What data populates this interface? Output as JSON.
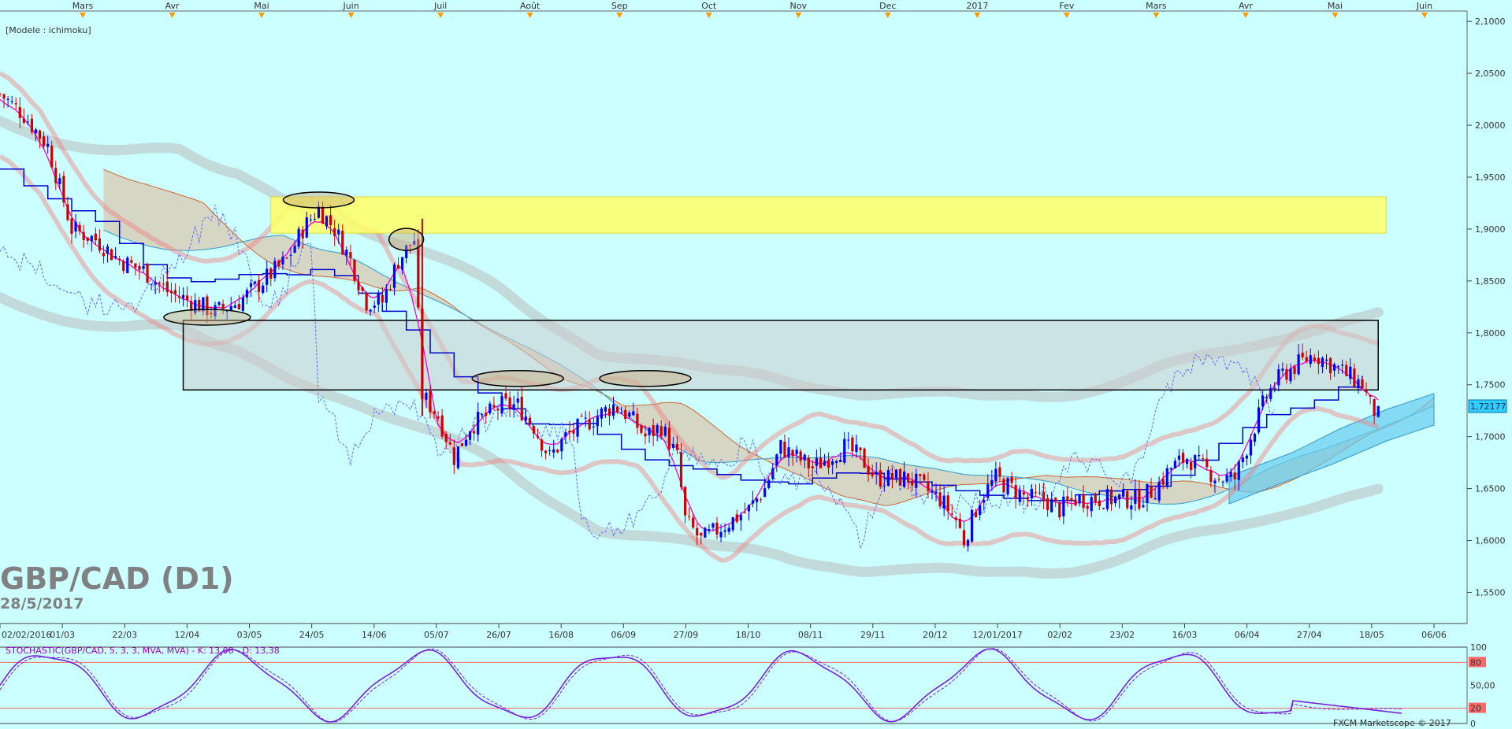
{
  "header": {
    "model_label": "[Modele : ichimoku]"
  },
  "overlay": {
    "symbol": "GBP/CAD (D1)",
    "date": "28/5/2017"
  },
  "price_badge": "1,72177",
  "top_months": [
    "Mars",
    "Avr",
    "Mai",
    "Juin",
    "Juil",
    "Août",
    "Sep",
    "Oct",
    "Nov",
    "Dec",
    "2017",
    "Fev",
    "Mars",
    "Avr",
    "Mai",
    "Juin"
  ],
  "stochastic": {
    "label": "STOCHASTIC(GBP/CAD, 5, 3, 3, MVA, MVA) - K: 13,08 - D: 13,38",
    "levels": [
      "100",
      "80",
      "50,00",
      "20",
      "0"
    ]
  },
  "footer": "FXCM Marketscope © 2017",
  "colors": {
    "background": "#ccffff",
    "up": "#0000ff",
    "down": "#cc0000",
    "zone_resistance": "#ffff66",
    "zone_range": "#cccccc"
  },
  "chart_data": {
    "type": "candlestick",
    "ylim": [
      1.52,
      2.11
    ],
    "y_ticks": [
      "2,1000",
      "2,0500",
      "2,0000",
      "1,9500",
      "1,9000",
      "1,8500",
      "1,8000",
      "1,7500",
      "1,7000",
      "1,6500",
      "1,6000",
      "1,5500"
    ],
    "y_tick_values": [
      2.1,
      2.05,
      2.0,
      1.95,
      1.9,
      1.85,
      1.8,
      1.75,
      1.7,
      1.65,
      1.6,
      1.55
    ],
    "x_labels": [
      "02/02/2016",
      "01/03",
      "22/03",
      "12/04",
      "03/05",
      "24/05",
      "14/06",
      "05/07",
      "26/07",
      "16/08",
      "06/09",
      "27/09",
      "18/10",
      "08/11",
      "29/11",
      "20/12",
      "12/01/2017",
      "02/02",
      "23/02",
      "16/03",
      "06/04",
      "27/04",
      "18/05",
      "06/06"
    ],
    "last_price": 1.72177,
    "close_path": [
      [
        0,
        2.03
      ],
      [
        6,
        2.01
      ],
      [
        12,
        1.98
      ],
      [
        18,
        1.9
      ],
      [
        24,
        1.89
      ],
      [
        30,
        1.87
      ],
      [
        36,
        1.86
      ],
      [
        42,
        1.84
      ],
      [
        48,
        1.83
      ],
      [
        54,
        1.82
      ],
      [
        60,
        1.83
      ],
      [
        66,
        1.85
      ],
      [
        72,
        1.87
      ],
      [
        76,
        1.9
      ],
      [
        80,
        1.92
      ],
      [
        84,
        1.9
      ],
      [
        88,
        1.87
      ],
      [
        92,
        1.83
      ],
      [
        96,
        1.83
      ],
      [
        100,
        1.87
      ],
      [
        104,
        1.89
      ],
      [
        106,
        1.74
      ],
      [
        110,
        1.72
      ],
      [
        114,
        1.68
      ],
      [
        118,
        1.71
      ],
      [
        122,
        1.72
      ],
      [
        126,
        1.73
      ],
      [
        130,
        1.73
      ],
      [
        134,
        1.71
      ],
      [
        138,
        1.68
      ],
      [
        142,
        1.7
      ],
      [
        146,
        1.71
      ],
      [
        150,
        1.72
      ],
      [
        154,
        1.73
      ],
      [
        158,
        1.72
      ],
      [
        162,
        1.7
      ],
      [
        166,
        1.71
      ],
      [
        170,
        1.68
      ],
      [
        172,
        1.62
      ],
      [
        176,
        1.6
      ],
      [
        180,
        1.61
      ],
      [
        184,
        1.62
      ],
      [
        188,
        1.63
      ],
      [
        192,
        1.65
      ],
      [
        196,
        1.69
      ],
      [
        200,
        1.68
      ],
      [
        204,
        1.67
      ],
      [
        208,
        1.68
      ],
      [
        212,
        1.69
      ],
      [
        216,
        1.68
      ],
      [
        220,
        1.66
      ],
      [
        224,
        1.66
      ],
      [
        228,
        1.66
      ],
      [
        232,
        1.65
      ],
      [
        236,
        1.64
      ],
      [
        240,
        1.62
      ],
      [
        242,
        1.6
      ],
      [
        246,
        1.64
      ],
      [
        250,
        1.66
      ],
      [
        254,
        1.65
      ],
      [
        258,
        1.64
      ],
      [
        262,
        1.64
      ],
      [
        266,
        1.63
      ],
      [
        270,
        1.64
      ],
      [
        274,
        1.64
      ],
      [
        278,
        1.64
      ],
      [
        282,
        1.64
      ],
      [
        286,
        1.64
      ],
      [
        290,
        1.65
      ],
      [
        294,
        1.67
      ],
      [
        298,
        1.68
      ],
      [
        302,
        1.67
      ],
      [
        306,
        1.66
      ],
      [
        310,
        1.66
      ],
      [
        314,
        1.7
      ],
      [
        318,
        1.74
      ],
      [
        322,
        1.76
      ],
      [
        326,
        1.77
      ],
      [
        330,
        1.78
      ],
      [
        334,
        1.77
      ],
      [
        338,
        1.76
      ],
      [
        342,
        1.75
      ],
      [
        344,
        1.73
      ],
      [
        346,
        1.72
      ]
    ],
    "zones": [
      {
        "name": "resistance-zone",
        "y": [
          1.896,
          1.931
        ],
        "x": [
          68,
          348
        ]
      },
      {
        "name": "range-zone",
        "y": [
          1.745,
          1.812
        ],
        "x": [
          46,
          346
        ]
      }
    ],
    "ellipses": [
      {
        "cx": 52,
        "cy": 1.815
      },
      {
        "cx": 80,
        "cy": 1.928
      },
      {
        "cx": 102,
        "cy": 1.89
      },
      {
        "cx": 130,
        "cy": 1.756
      },
      {
        "cx": 162,
        "cy": 1.756
      }
    ]
  }
}
